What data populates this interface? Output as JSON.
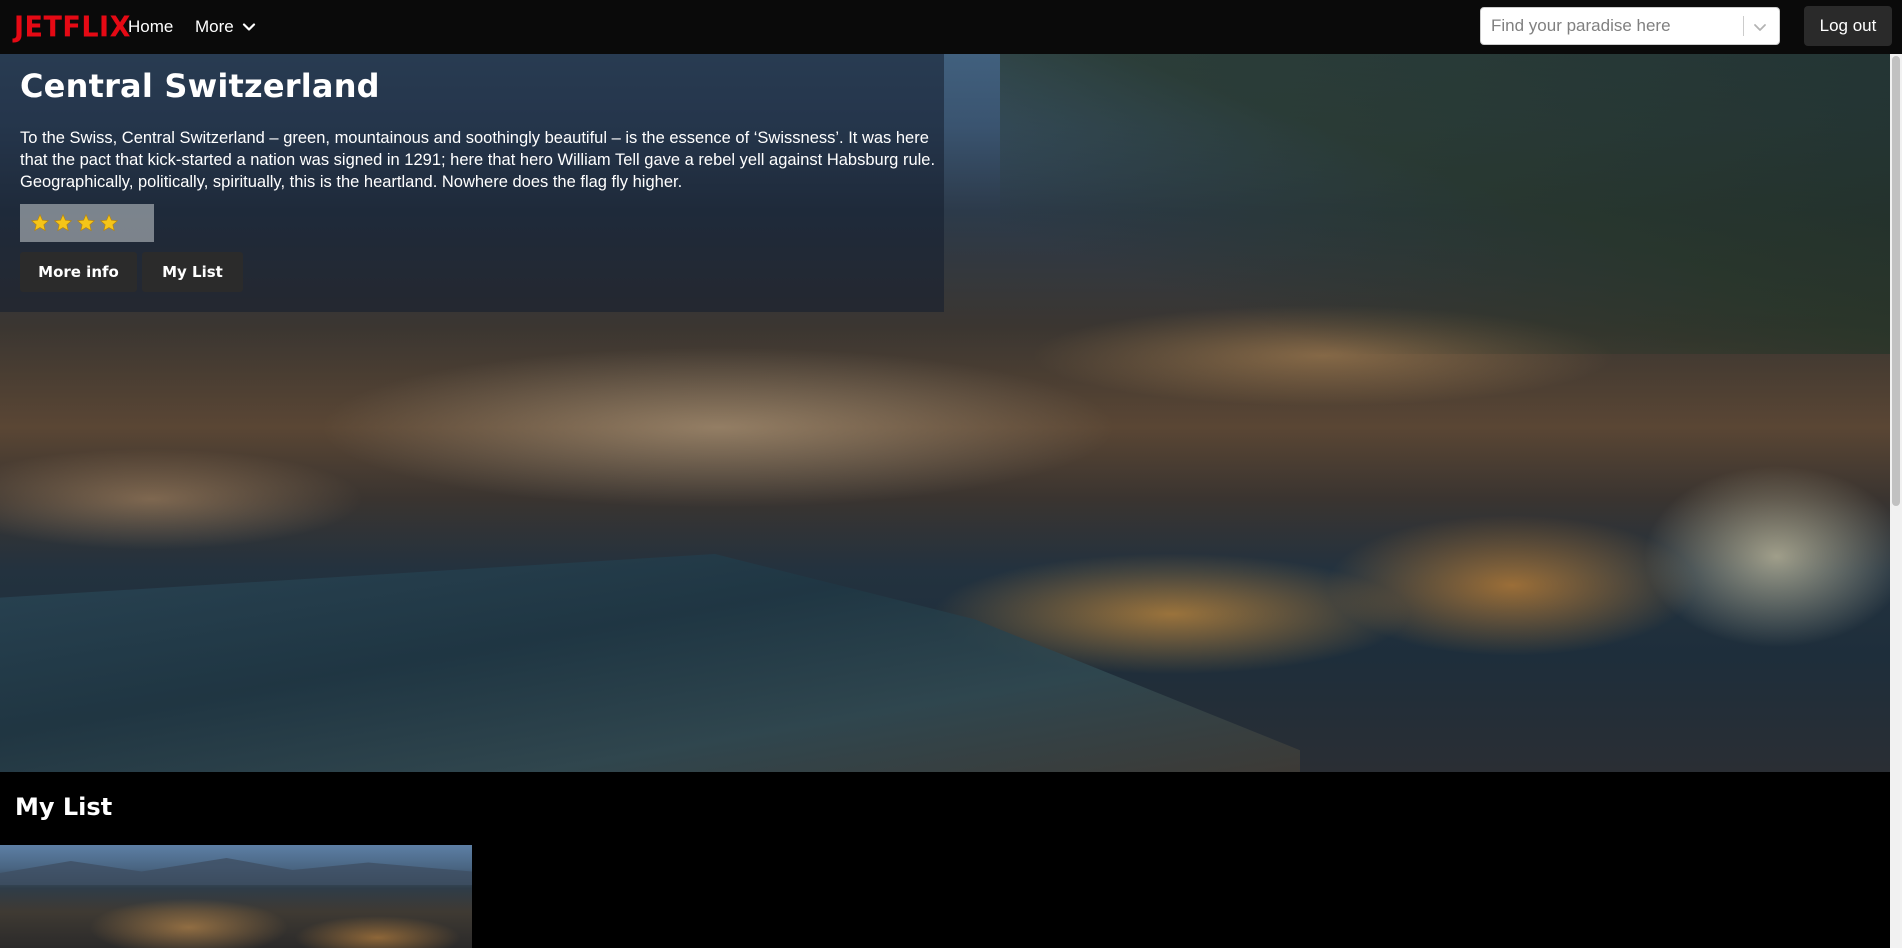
{
  "navbar": {
    "logo": "JETFLIX",
    "home_label": "Home",
    "more_label": "More",
    "search_placeholder": "Find your paradise here",
    "logout_label": "Log out"
  },
  "hero": {
    "title": "Central Switzerland",
    "description": "To the Swiss, Central Switzerland – green, mountainous and soothingly beautiful – is the essence of ‘Swissness’. It was here that the pact that kick-started a nation was signed in 1291; here that hero William Tell gave a rebel yell against Habsburg rule. Geographically, politically, spiritually, this is the heartland. Nowhere does the flag fly higher.",
    "rating": {
      "value": 4,
      "max": 5
    },
    "more_info_label": "More info",
    "my_list_label": "My List"
  },
  "my_list": {
    "title": "My List"
  },
  "colors": {
    "brand": "#e50914",
    "star": "#f5c518",
    "button_bg": "#2b2b2b"
  }
}
